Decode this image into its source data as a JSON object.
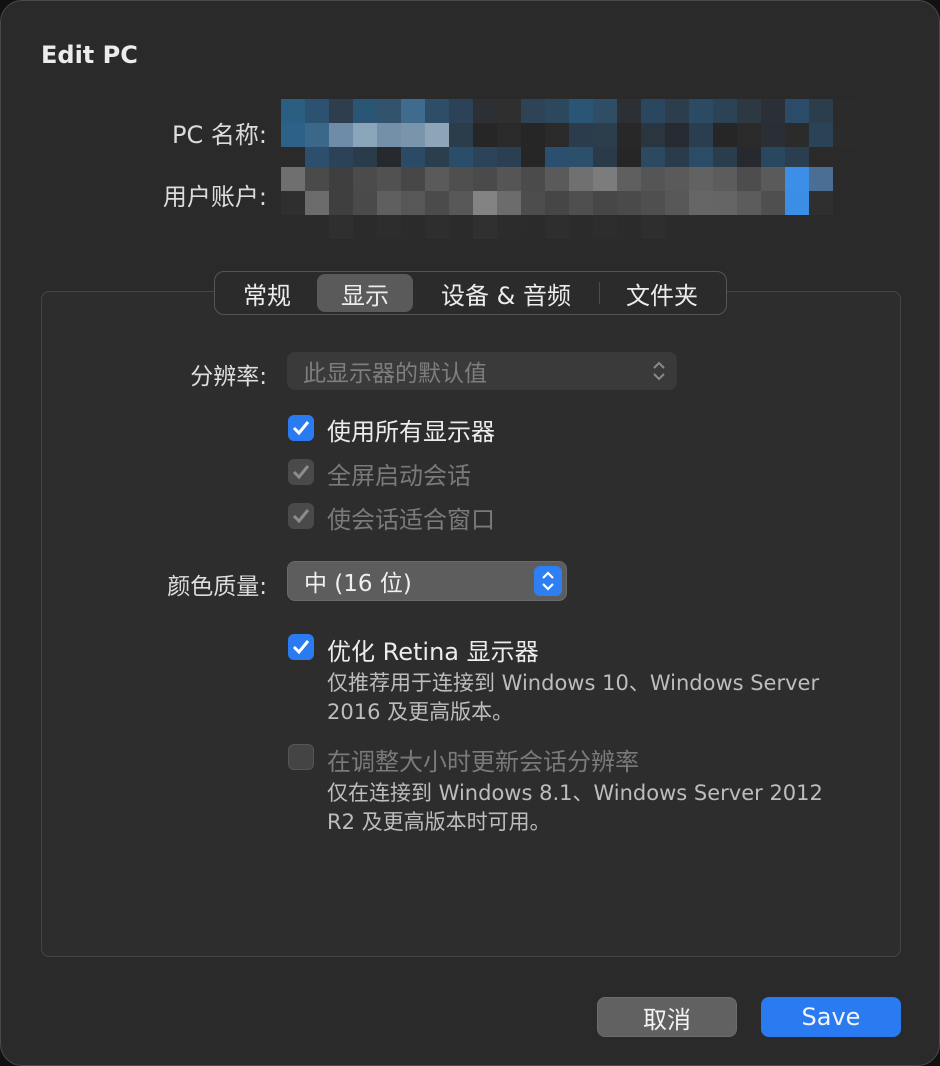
{
  "window": {
    "title": "Edit PC"
  },
  "pc_name": {
    "label": "PC 名称:"
  },
  "user_account": {
    "label": "用户账户:"
  },
  "tabs": [
    {
      "label": "常规",
      "active": false
    },
    {
      "label": "显示",
      "active": true
    },
    {
      "label": "设备 & 音频",
      "active": false
    },
    {
      "label": "文件夹",
      "active": false
    }
  ],
  "display": {
    "resolution_label": "分辨率:",
    "resolution_value": "此显示器的默认值",
    "use_all_monitors": {
      "label": "使用所有显示器",
      "checked": true,
      "enabled": true
    },
    "start_fullscreen": {
      "label": "全屏启动会话",
      "checked": true,
      "enabled": false
    },
    "fit_session": {
      "label": "使会话适合窗口",
      "checked": true,
      "enabled": false
    },
    "color_quality_label": "颜色质量:",
    "color_quality_value": "中 (16 位)",
    "optimize_retina": {
      "label": "优化 Retina 显示器",
      "checked": true,
      "enabled": true,
      "hint_line1": "仅推荐用于连接到 Windows 10、Windows Server",
      "hint_line2": "2016 及更高版本。"
    },
    "update_resolution": {
      "label": "在调整大小时更新会话分辨率",
      "checked": false,
      "enabled": false,
      "hint_line1": "仅在连接到 Windows 8.1、Windows Server 2012",
      "hint_line2": "R2 及更高版本时可用。"
    }
  },
  "buttons": {
    "cancel": "取消",
    "save": "Save"
  },
  "colors": {
    "accent": "#2a7bf2",
    "window_bg": "#2a2a2a"
  }
}
